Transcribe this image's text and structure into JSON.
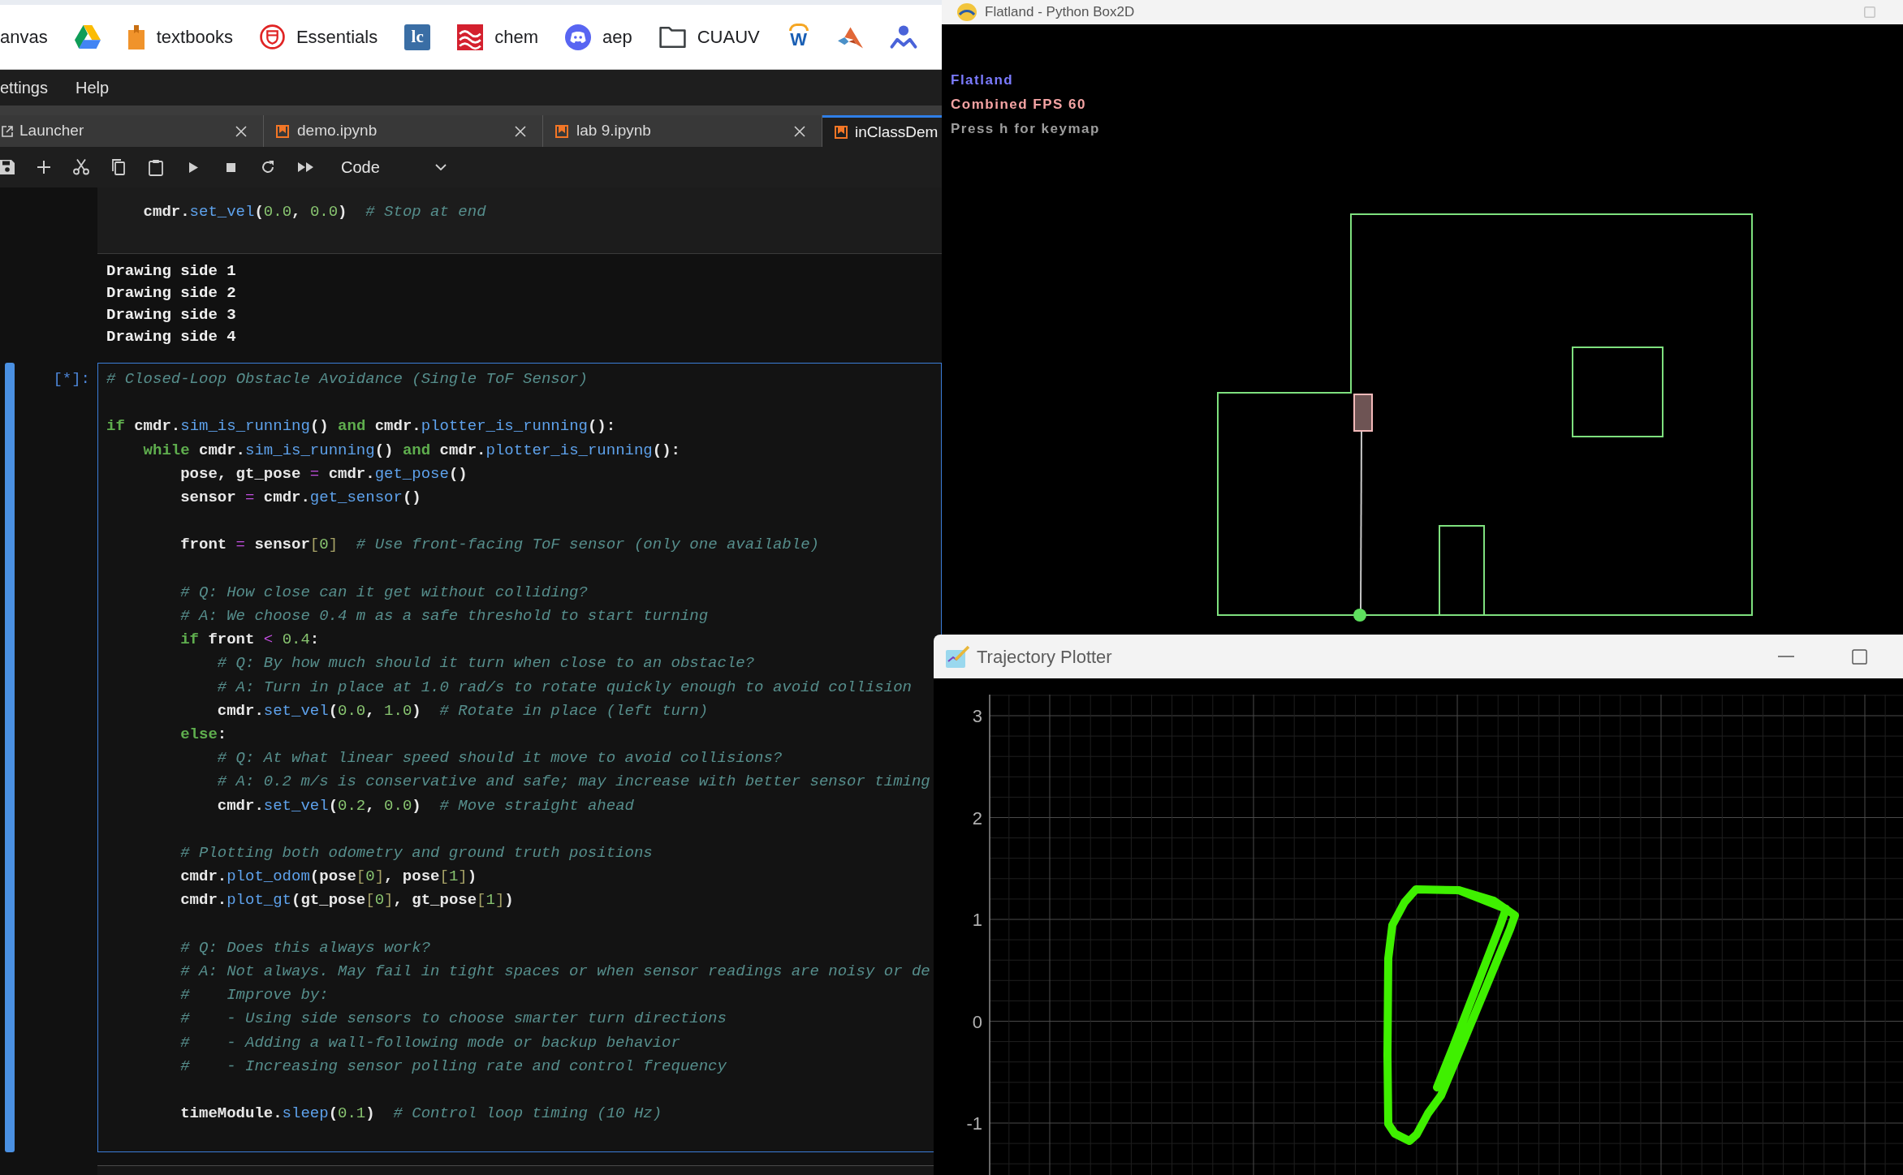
{
  "browser": {
    "bookmarks": [
      {
        "kind": "label",
        "label": "anvas"
      },
      {
        "kind": "icon"
      },
      {
        "kind": "icon_label",
        "label": "textbooks"
      },
      {
        "kind": "icon_label",
        "label": "Essentials"
      },
      {
        "kind": "logo",
        "logo_text": "lc"
      },
      {
        "kind": "icon_label",
        "label": "chem"
      },
      {
        "kind": "icon_label",
        "label": "aep"
      },
      {
        "kind": "icon_label",
        "label": "CUAUV"
      },
      {
        "kind": "logo",
        "logo_text": "W"
      },
      {
        "kind": "icon"
      },
      {
        "kind": "icon"
      }
    ]
  },
  "jupyter": {
    "menu": [
      "ettings",
      "Help"
    ],
    "tabs": [
      {
        "kind": "launcher",
        "label": "Launcher",
        "selected": false
      },
      {
        "kind": "notebook",
        "label": "demo.ipynb",
        "selected": false
      },
      {
        "kind": "notebook",
        "label": "lab 9.ipynb",
        "selected": false
      },
      {
        "kind": "notebook",
        "label": "inClassDem",
        "selected": true
      }
    ],
    "toolbar": {
      "cell_type": "Code"
    },
    "previous_cell": {
      "lines": [
        {
          "children": [
            {
              "tokens": [
                {
                  "kind": "plain",
                  "text": "cmdr."
                },
                {
                  "kind": "function",
                  "text": "set_vel"
                },
                {
                  "kind": "plain",
                  "text": "("
                },
                {
                  "kind": "number",
                  "text": "0.0"
                },
                {
                  "kind": "plain",
                  "text": ", "
                },
                {
                  "kind": "number",
                  "text": "0.0"
                },
                {
                  "kind": "plain",
                  "text": ")"
                },
                {
                  "kind": "comment",
                  "text": "  # Stop at end"
                }
              ]
            }
          ]
        }
      ],
      "outputs": [
        "Drawing side 1",
        "Drawing side 2",
        "Drawing side 3",
        "Drawing side 4"
      ]
    },
    "active_cell": {
      "prompt": "[*]:",
      "lines": [
        {
          "tokens": [
            {
              "kind": "comment",
              "text": "# Closed-Loop Obstacle Avoidance (Single ToF Sensor)"
            }
          ]
        },
        {
          "space_before": true,
          "tokens": [
            {
              "kind": "keyword",
              "text": "if"
            },
            {
              "kind": "plain",
              "text": " cmdr."
            },
            {
              "kind": "function",
              "text": "sim_is_running"
            },
            {
              "kind": "plain",
              "text": "() "
            },
            {
              "kind": "keyword",
              "text": "and"
            },
            {
              "kind": "plain",
              "text": " cmdr."
            },
            {
              "kind": "function",
              "text": "plotter_is_running"
            },
            {
              "kind": "plain",
              "text": "():"
            }
          ],
          "children": [
            {
              "tokens": [
                {
                  "kind": "keyword",
                  "text": "while"
                },
                {
                  "kind": "plain",
                  "text": " cmdr."
                },
                {
                  "kind": "function",
                  "text": "sim_is_running"
                },
                {
                  "kind": "plain",
                  "text": "() "
                },
                {
                  "kind": "keyword",
                  "text": "and"
                },
                {
                  "kind": "plain",
                  "text": " cmdr."
                },
                {
                  "kind": "function",
                  "text": "plotter_is_running"
                },
                {
                  "kind": "plain",
                  "text": "():"
                }
              ],
              "children": [
                {
                  "tokens": [
                    {
                      "kind": "plain",
                      "text": "pose, gt_pose "
                    },
                    {
                      "kind": "operator",
                      "text": "="
                    },
                    {
                      "kind": "plain",
                      "text": " cmdr."
                    },
                    {
                      "kind": "function",
                      "text": "get_pose"
                    },
                    {
                      "kind": "plain",
                      "text": "()"
                    }
                  ]
                },
                {
                  "tokens": [
                    {
                      "kind": "plain",
                      "text": "sensor "
                    },
                    {
                      "kind": "operator",
                      "text": "="
                    },
                    {
                      "kind": "plain",
                      "text": " cmdr."
                    },
                    {
                      "kind": "function",
                      "text": "get_sensor"
                    },
                    {
                      "kind": "plain",
                      "text": "()"
                    }
                  ]
                },
                {
                  "space_before": true,
                  "tokens": [
                    {
                      "kind": "plain",
                      "text": "front "
                    },
                    {
                      "kind": "operator",
                      "text": "="
                    },
                    {
                      "kind": "plain",
                      "text": " sensor"
                    },
                    {
                      "kind": "bracket",
                      "text": "["
                    },
                    {
                      "kind": "number",
                      "text": "0"
                    },
                    {
                      "kind": "bracket",
                      "text": "]"
                    },
                    {
                      "kind": "comment",
                      "text": "  # Use front-facing ToF sensor (only one available)"
                    }
                  ]
                },
                {
                  "space_before": true,
                  "tokens": [
                    {
                      "kind": "comment",
                      "text": "# Q: How close can it get without colliding?"
                    }
                  ]
                },
                {
                  "tokens": [
                    {
                      "kind": "comment",
                      "text": "# A: We choose 0.4 m as a safe threshold to start turning"
                    }
                  ]
                },
                {
                  "tokens": [
                    {
                      "kind": "keyword",
                      "text": "if"
                    },
                    {
                      "kind": "plain",
                      "text": " front "
                    },
                    {
                      "kind": "operator",
                      "text": "<"
                    },
                    {
                      "kind": "number",
                      "text": " 0.4"
                    },
                    {
                      "kind": "plain",
                      "text": ":"
                    }
                  ],
                  "children": [
                    {
                      "tokens": [
                        {
                          "kind": "comment",
                          "text": "# Q: By how much should it turn when close to an obstacle?"
                        }
                      ]
                    },
                    {
                      "tokens": [
                        {
                          "kind": "comment",
                          "text": "# A: Turn in place at 1.0 rad/s to rotate quickly enough to avoid collision"
                        }
                      ]
                    },
                    {
                      "tokens": [
                        {
                          "kind": "plain",
                          "text": "cmdr."
                        },
                        {
                          "kind": "function",
                          "text": "set_vel"
                        },
                        {
                          "kind": "plain",
                          "text": "("
                        },
                        {
                          "kind": "number",
                          "text": "0.0"
                        },
                        {
                          "kind": "plain",
                          "text": ", "
                        },
                        {
                          "kind": "number",
                          "text": "1.0"
                        },
                        {
                          "kind": "plain",
                          "text": ")"
                        },
                        {
                          "kind": "comment",
                          "text": "  # Rotate in place (left turn)"
                        }
                      ]
                    }
                  ]
                },
                {
                  "tokens": [
                    {
                      "kind": "keyword",
                      "text": "else"
                    },
                    {
                      "kind": "plain",
                      "text": ":"
                    }
                  ],
                  "children": [
                    {
                      "tokens": [
                        {
                          "kind": "comment",
                          "text": "# Q: At what linear speed should it move to avoid collisions?"
                        }
                      ]
                    },
                    {
                      "tokens": [
                        {
                          "kind": "comment",
                          "text": "# A: 0.2 m/s is conservative and safe; may increase with better sensor timing"
                        }
                      ]
                    },
                    {
                      "tokens": [
                        {
                          "kind": "plain",
                          "text": "cmdr."
                        },
                        {
                          "kind": "function",
                          "text": "set_vel"
                        },
                        {
                          "kind": "plain",
                          "text": "("
                        },
                        {
                          "kind": "number",
                          "text": "0.2"
                        },
                        {
                          "kind": "plain",
                          "text": ", "
                        },
                        {
                          "kind": "number",
                          "text": "0.0"
                        },
                        {
                          "kind": "plain",
                          "text": ")"
                        },
                        {
                          "kind": "comment",
                          "text": "  # Move straight ahead"
                        }
                      ]
                    }
                  ]
                },
                {
                  "space_before": true,
                  "tokens": [
                    {
                      "kind": "comment",
                      "text": "# Plotting both odometry and ground truth positions"
                    }
                  ]
                },
                {
                  "tokens": [
                    {
                      "kind": "plain",
                      "text": "cmdr."
                    },
                    {
                      "kind": "function",
                      "text": "plot_odom"
                    },
                    {
                      "kind": "plain",
                      "text": "(pose"
                    },
                    {
                      "kind": "bracket",
                      "text": "["
                    },
                    {
                      "kind": "number",
                      "text": "0"
                    },
                    {
                      "kind": "bracket",
                      "text": "]"
                    },
                    {
                      "kind": "plain",
                      "text": ", pose"
                    },
                    {
                      "kind": "bracket",
                      "text": "["
                    },
                    {
                      "kind": "number",
                      "text": "1"
                    },
                    {
                      "kind": "bracket",
                      "text": "]"
                    },
                    {
                      "kind": "plain",
                      "text": ")"
                    }
                  ]
                },
                {
                  "tokens": [
                    {
                      "kind": "plain",
                      "text": "cmdr."
                    },
                    {
                      "kind": "function",
                      "text": "plot_gt"
                    },
                    {
                      "kind": "plain",
                      "text": "(gt_pose"
                    },
                    {
                      "kind": "bracket",
                      "text": "["
                    },
                    {
                      "kind": "number",
                      "text": "0"
                    },
                    {
                      "kind": "bracket",
                      "text": "]"
                    },
                    {
                      "kind": "plain",
                      "text": ", gt_pose"
                    },
                    {
                      "kind": "bracket",
                      "text": "["
                    },
                    {
                      "kind": "number",
                      "text": "1"
                    },
                    {
                      "kind": "bracket",
                      "text": "]"
                    },
                    {
                      "kind": "plain",
                      "text": ")"
                    }
                  ]
                },
                {
                  "space_before": true,
                  "tokens": [
                    {
                      "kind": "comment",
                      "text": "# Q: Does this always work?"
                    }
                  ]
                },
                {
                  "tokens": [
                    {
                      "kind": "comment",
                      "text": "# A: Not always. May fail in tight spaces or when sensor readings are noisy or de"
                    }
                  ]
                },
                {
                  "tokens": [
                    {
                      "kind": "comment",
                      "text": "#    Improve by:"
                    }
                  ]
                },
                {
                  "tokens": [
                    {
                      "kind": "comment",
                      "text": "#    - Using side sensors to choose smarter turn directions"
                    }
                  ]
                },
                {
                  "tokens": [
                    {
                      "kind": "comment",
                      "text": "#    - Adding a wall-following mode or backup behavior"
                    }
                  ]
                },
                {
                  "tokens": [
                    {
                      "kind": "comment",
                      "text": "#    - Increasing sensor polling rate and control frequency"
                    }
                  ]
                },
                {
                  "space_before": true,
                  "tokens": [
                    {
                      "kind": "plain",
                      "text": "timeModule."
                    },
                    {
                      "kind": "function",
                      "text": "sleep"
                    },
                    {
                      "kind": "plain",
                      "text": "("
                    },
                    {
                      "kind": "number",
                      "text": "0.1"
                    },
                    {
                      "kind": "plain",
                      "text": ")"
                    },
                    {
                      "kind": "comment",
                      "text": "  # Control loop timing (10 Hz)"
                    }
                  ]
                }
              ]
            }
          ]
        }
      ]
    }
  },
  "flatland_window": {
    "title": "Flatland - Python Box2D",
    "hud": [
      {
        "text": "Flatland",
        "color": "#7b7bff"
      },
      {
        "text": "Combined FPS 60",
        "color": "#f4a3a3"
      },
      {
        "text": "Press h for keymap",
        "color": "#9c9c9c"
      }
    ]
  },
  "plotter_window": {
    "title": "Trajectory Plotter",
    "y_ticks": [
      "3",
      "2",
      "1",
      "0",
      "-1"
    ]
  }
}
